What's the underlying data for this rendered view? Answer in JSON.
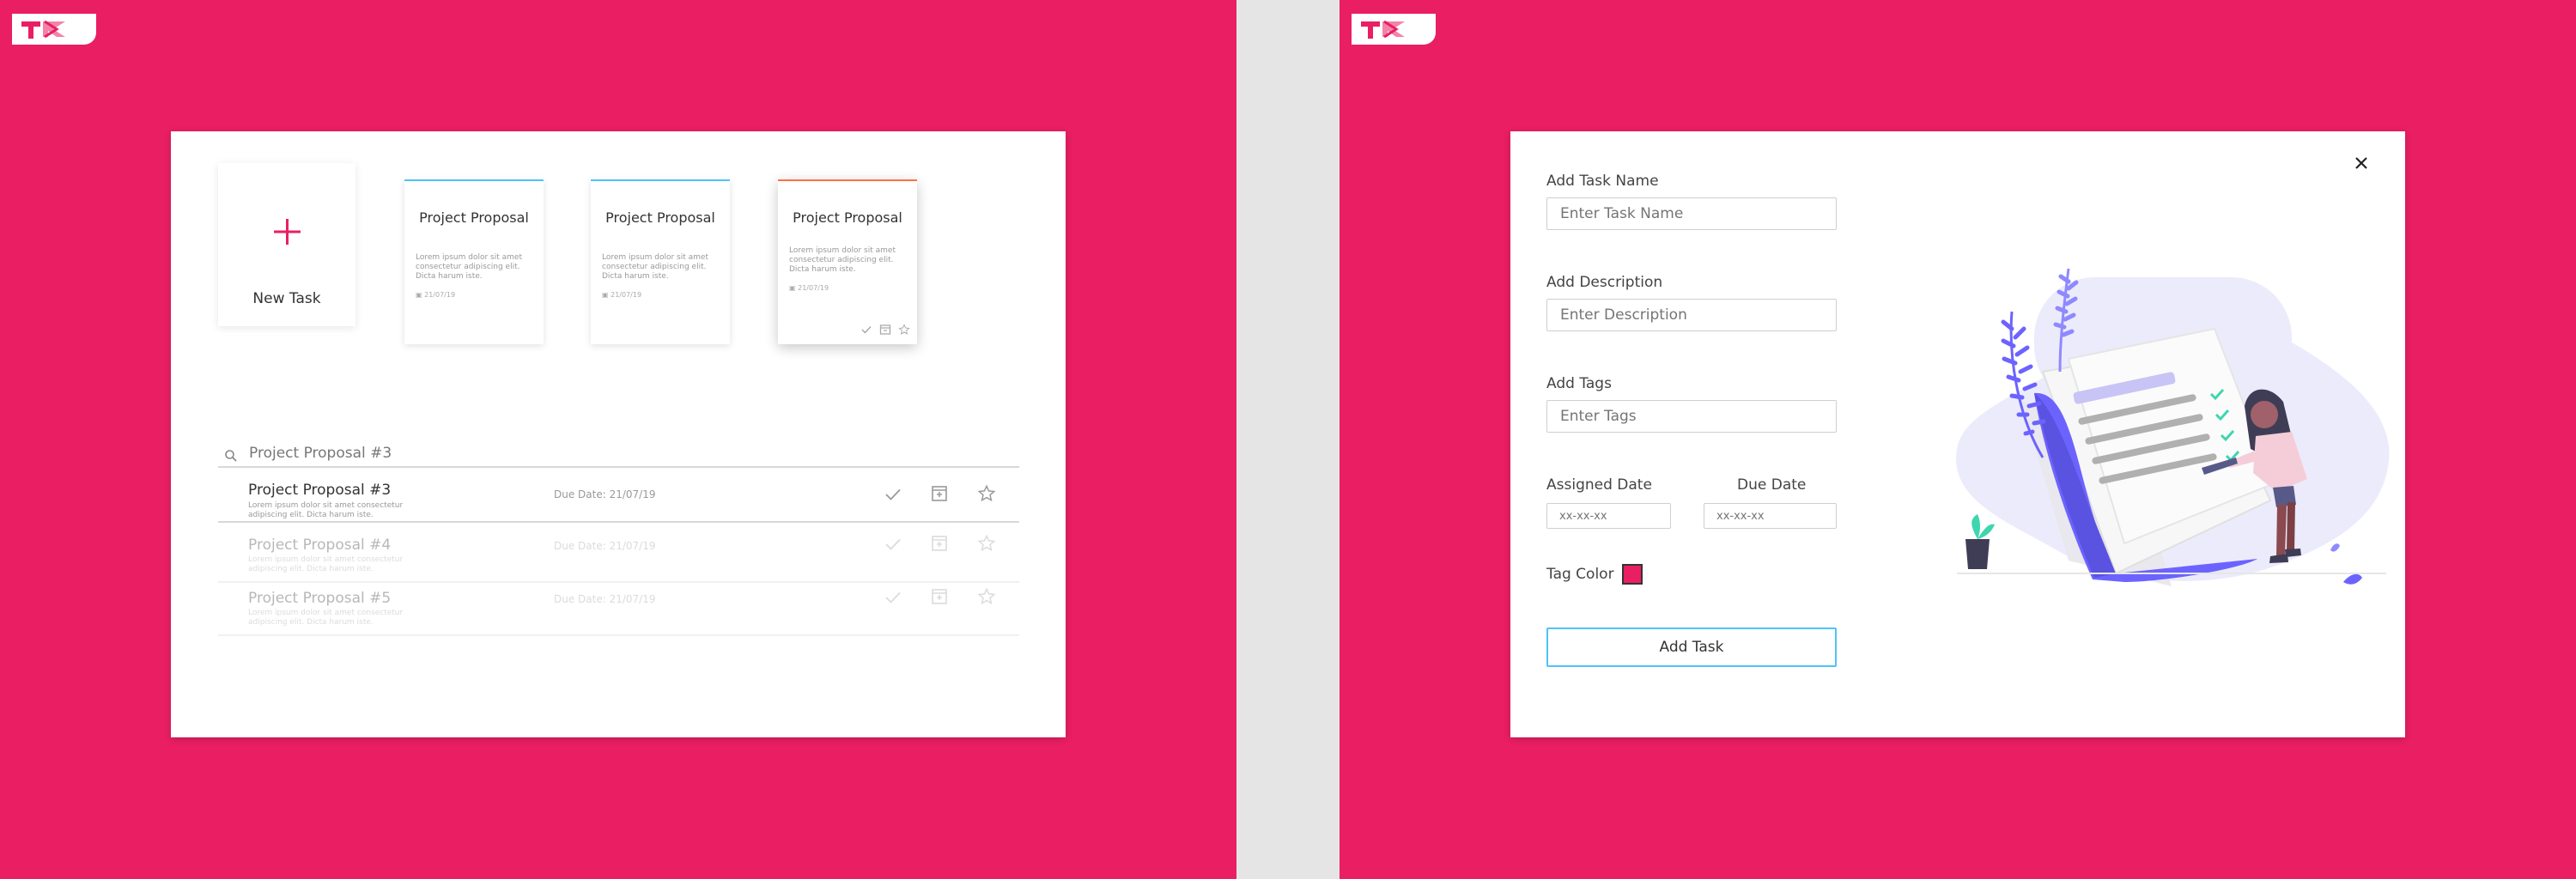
{
  "colors": {
    "brand": "#e91e63",
    "accent_blue": "#4fc3f7",
    "accent_orange": "#ff7043",
    "illustration": "#6c63ff"
  },
  "left": {
    "new_task_label": "New Task",
    "project_cards": [
      {
        "title": "Project Proposal",
        "body": "Lorem ipsum dolor sit amet consectetur adipiscing elit. Dicta harum iste.",
        "date": "21/07/19"
      },
      {
        "title": "Project Proposal",
        "body": "Lorem ipsum dolor sit amet consectetur adipiscing elit. Dicta harum iste.",
        "date": "21/07/19"
      },
      {
        "title": "Project Proposal",
        "body": "Lorem ipsum dolor sit amet consectetur adipiscing elit. Dicta harum iste.",
        "date": "21/07/19"
      }
    ],
    "search_value": "Project Proposal #3",
    "tasks": [
      {
        "title": "Project Proposal #3",
        "sub": "Lorem ipsum dolor sit amet consectetur adipiscing elit. Dicta harum iste.",
        "due": "Due Date: 21/07/19"
      },
      {
        "title": "Project Proposal #4",
        "sub": "Lorem ipsum dolor sit amet consectetur adipiscing elit. Dicta harum iste.",
        "due": "Due Date: 21/07/19"
      },
      {
        "title": "Project Proposal #5",
        "sub": "Lorem ipsum dolor sit amet consectetur adipiscing elit. Dicta harum iste.",
        "due": "Due Date: 21/07/19"
      }
    ]
  },
  "right": {
    "task_name_label": "Add Task Name",
    "task_name_placeholder": "Enter Task Name",
    "description_label": "Add Description",
    "description_placeholder": "Enter Description",
    "tags_label": "Add Tags",
    "tags_placeholder": "Enter Tags",
    "assigned_label": "Assigned Date",
    "assigned_placeholder": "xx-xx-xx",
    "due_label": "Due Date",
    "due_placeholder": "xx-xx-xx",
    "tag_color_label": "Tag Color",
    "add_button": "Add Task"
  }
}
